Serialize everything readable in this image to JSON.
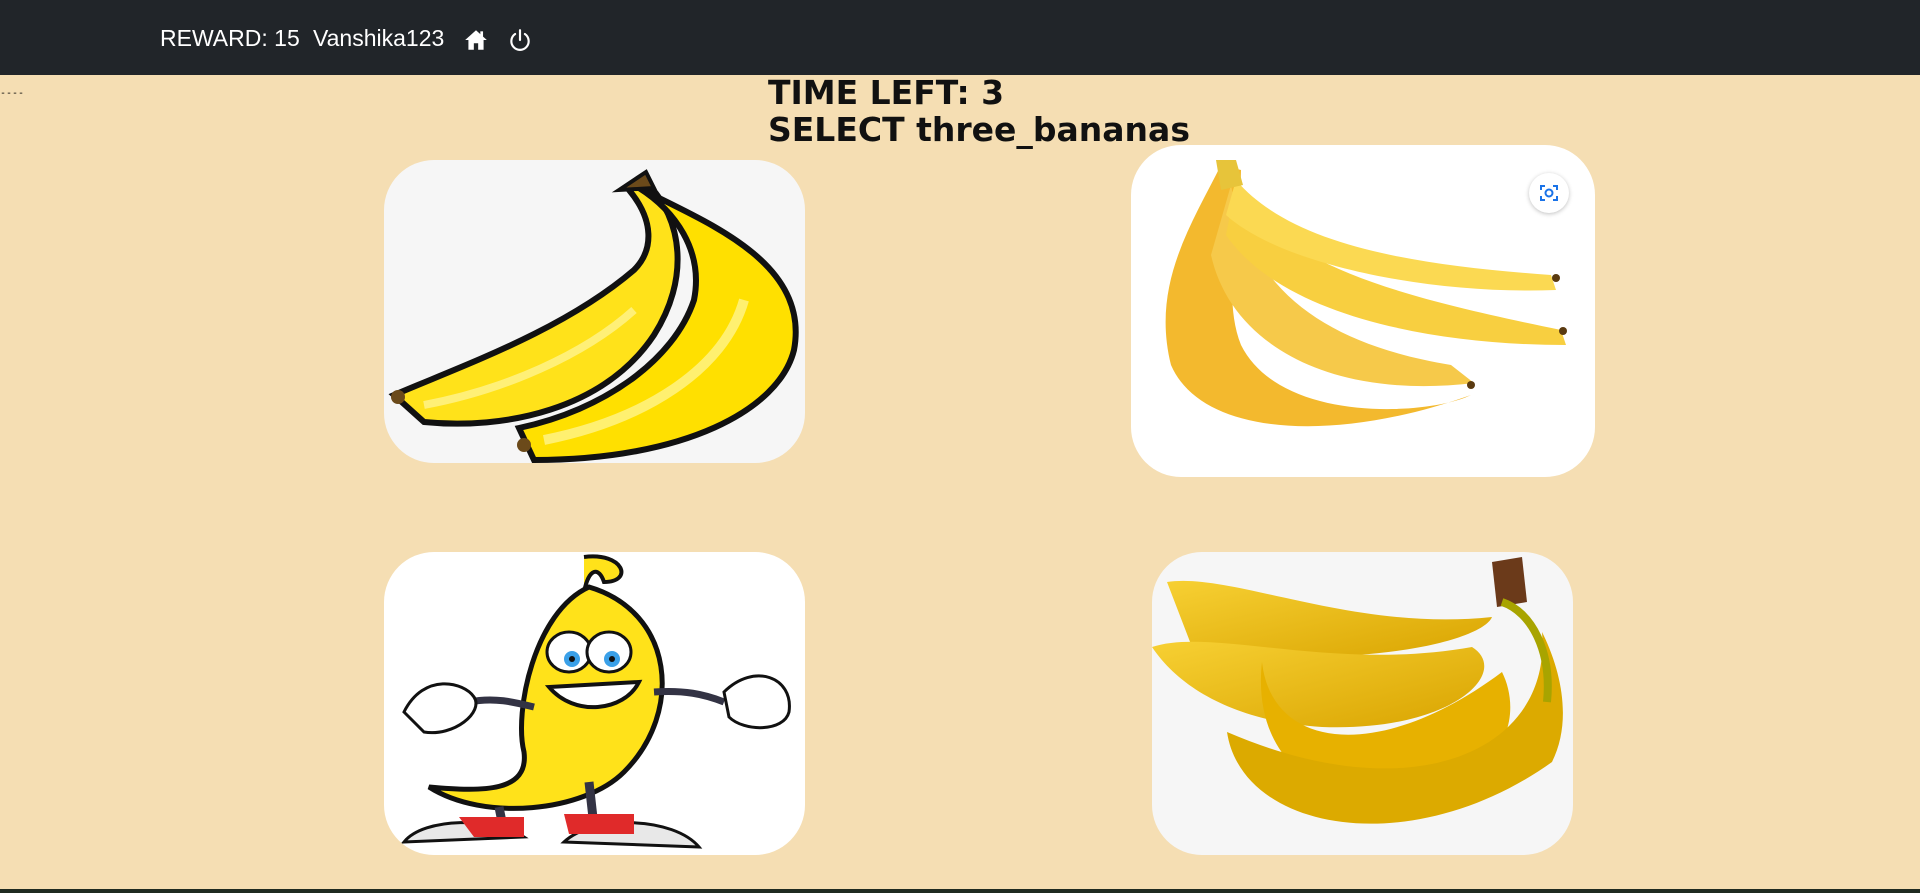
{
  "topbar": {
    "reward_text": "REWARD: 15",
    "username": "Vanshika123",
    "home_icon": "home-icon",
    "power_icon": "power-icon"
  },
  "game": {
    "time_left_text": "TIME LEFT: 3",
    "prompt_text": "SELECT three_bananas"
  },
  "choices": [
    {
      "id": "two-bananas",
      "icon": "two-bananas-image"
    },
    {
      "id": "banana-bunch",
      "icon": "banana-bunch-image"
    },
    {
      "id": "cartoon-banana",
      "icon": "cartoon-banana-image"
    },
    {
      "id": "three-bananas",
      "icon": "three-bananas-image"
    }
  ],
  "colors": {
    "background": "#f5deb3",
    "navbar": "#212529",
    "banana_yellow": "#ffe000"
  }
}
